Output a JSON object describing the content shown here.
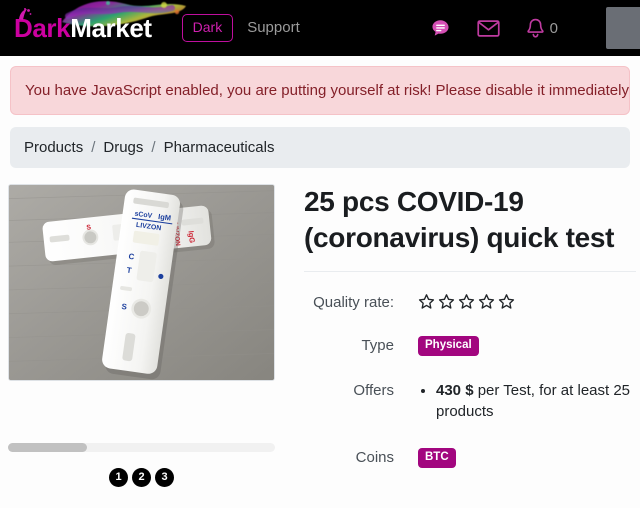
{
  "header": {
    "brand": {
      "part1": "Dark",
      "part2": "Market",
      "drip_icon": "paint-drip-icon"
    },
    "theme_button": "Dark",
    "support_link": "Support",
    "icons": {
      "chat": "chat-bubble-icon",
      "mail": "envelope-icon",
      "bell": "bell-icon"
    },
    "notification_count": "0",
    "colors": {
      "accent": "#cc00a0",
      "accent_outline": "#bf0f9e",
      "muted": "#9b9b9b"
    }
  },
  "alert": {
    "text": "You have JavaScript enabled, you are putting yourself at risk! Please disable it immediately!",
    "bg": "#f8d7da",
    "fg": "#842029"
  },
  "breadcrumb": {
    "items": [
      "Products",
      "Drugs",
      "Pharmaceuticals"
    ],
    "separator": "/"
  },
  "product": {
    "title": "25 pcs COVID-19 (coronavirus) quick test",
    "image_alt": "covid-19-rapid-test-cassettes-photo",
    "gallery": {
      "dots": [
        "1",
        "2",
        "3"
      ],
      "scrollbar": "horizontal-scrollbar"
    },
    "details": [
      {
        "label": "Quality rate:",
        "type": "stars",
        "value": "0",
        "max": "5"
      },
      {
        "label": "Type",
        "type": "badge",
        "value": "Physical"
      },
      {
        "label": "Offers",
        "type": "list",
        "value": "430 $",
        "suffix": " per Test, for at least 25 products"
      },
      {
        "label": "Coins",
        "type": "badge",
        "value": "BTC"
      }
    ],
    "badge_color": "#a2067f"
  }
}
